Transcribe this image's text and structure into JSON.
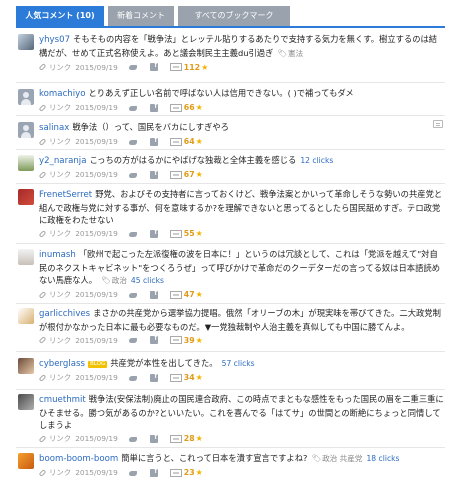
{
  "tabs": [
    {
      "label": "人気コメント (10)"
    },
    {
      "label": "新着コメント"
    },
    {
      "label": "すべてのブックマーク"
    }
  ],
  "link_label": "リンク",
  "entries": [
    {
      "user": "yhys07",
      "text": "そもそもの内容を「戦争法」とレッテル貼りするあたりで支持する気力を無くす。樹立するのは結構だが、せめて正式名称使えよ。あと議会制民主主義du引過ぎ",
      "tag": "憲法",
      "clicks": "",
      "date": "2015/09/19",
      "count": "112"
    },
    {
      "user": "komachiyo",
      "text": "とりあえず正しい名前で呼ばない人は信用できない。( )で補ってもダメ",
      "tag": "",
      "clicks": "",
      "date": "2015/09/19",
      "count": "66"
    },
    {
      "user": "salinax",
      "text": "戦争法（）って、国民をバカにしすぎやろ",
      "tag": "",
      "clicks": "",
      "date": "2015/09/19",
      "count": "64"
    },
    {
      "user": "y2_naranja",
      "text": "こっちの方がはるかにやばげな独裁と全体主義を感じる",
      "tag": "",
      "clicks": "12 clicks",
      "date": "2015/09/19",
      "count": "67"
    },
    {
      "user": "FrenetSerret",
      "text": "野党、およびその支持者に言っておくけど、戦争法案とかいって革命しそうな勢いの共産党と組んで政権与党に対する事が、何を意味するか?を理解できないと思ってるとしたら国民舐めすぎ。テロ政党に政権をわたせない",
      "tag": "",
      "clicks": "",
      "date": "2015/09/19",
      "count": "55"
    },
    {
      "user": "inumash",
      "text": "「欧州で起こった左派復権の波を日本に！」というのは冗談として、これは「党派を越えて\"対自民のネクストキャビネット\"をつくろうぜ」って呼びかけで革命だのクーデターだの言ってる奴は日本語読めない馬鹿な人。",
      "tag": "政治",
      "clicks": "45 clicks",
      "date": "2015/09/19",
      "count": "47"
    },
    {
      "user": "garlicchives",
      "text": "まさかの共産党から選挙協力提唱。俄然「オリーブの木」が現実味を帯びてきた。二大政党制が根付かなかった日本に最も必要なものだ。▼一党独裁制や人治主義を真似しても中国に勝てんよ。",
      "tag": "",
      "clicks": "",
      "date": "2015/09/19",
      "count": "39"
    },
    {
      "user": "cyberglass",
      "badge": "BLOG",
      "text": "共産党が本性を出してきた。",
      "tag": "",
      "clicks": "57 clicks",
      "date": "2015/09/19",
      "count": "34"
    },
    {
      "user": "cmuethmit",
      "text": "戦争法(安保法制)廃止の国民連合政府、この時点でまともな感性をもった国民の眉を二重三重にひそませる。勝つ気があるのか?といいたい。これを喜んでる「はてサ」の世間との断絶にちょっと同情してしまうよ",
      "tag": "",
      "clicks": "",
      "date": "2015/09/19",
      "count": "28"
    },
    {
      "user": "boom-boom-boom",
      "text": "簡単に言うと、これって日本を潰す宣言ですよね?",
      "tag": "政治 共産党",
      "clicks": "18 clicks",
      "date": "2015/09/19",
      "count": "23"
    }
  ]
}
